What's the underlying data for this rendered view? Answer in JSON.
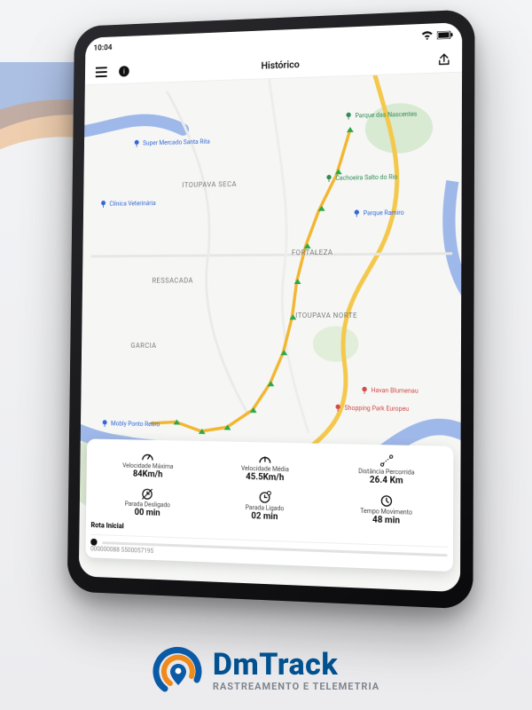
{
  "status": {
    "time": "10:04"
  },
  "header": {
    "title": "Histórico"
  },
  "map": {
    "labels": [
      "FORTALEZA",
      "RESSACADA",
      "ITOUPAVA NORTE",
      "ITOUPAVA SECA",
      "GARCIA"
    ],
    "pois": [
      "Super Mercado Santa Rita",
      "Clínica Veterinária",
      "Cachoeira Salto do Rio",
      "Parque Ramiro",
      "Havan Blumenau",
      "Shopping Park Europeu",
      "Mobly Ponto Retiro",
      "Parque das Nascentes"
    ]
  },
  "stats": [
    {
      "label": "Velocidade Máxima",
      "value": "84Km/h"
    },
    {
      "label": "Velocidade Média",
      "value": "45.5Km/h"
    },
    {
      "label": "Distância Percorrida",
      "value": "26.4 Km"
    },
    {
      "label": "Parada Desligado",
      "value": "00 min"
    },
    {
      "label": "Parada Ligado",
      "value": "02 min"
    },
    {
      "label": "Tempo Movimento",
      "value": "48 min"
    }
  ],
  "card": {
    "route_label": "Rota Inicial",
    "vehicle_id": "000000088 5500057195"
  },
  "brand": {
    "name": "DmTrack",
    "tagline": "RASTREAMENTO E TELEMETRIA"
  },
  "colors": {
    "brand_blue": "#0a5aa6",
    "brand_orange": "#ef8a1d"
  }
}
